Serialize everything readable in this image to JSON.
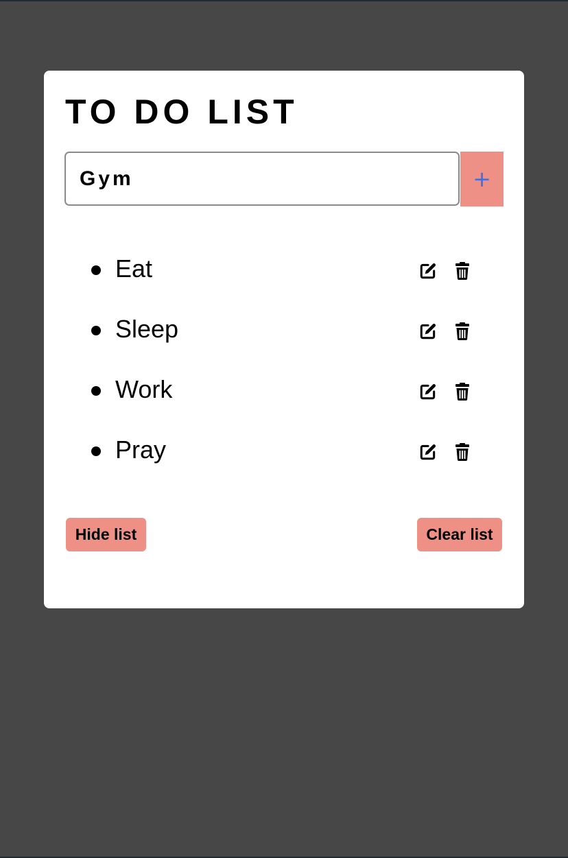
{
  "app": {
    "title": "TO DO LIST"
  },
  "input": {
    "value": "Gym",
    "placeholder": "",
    "add_label": "+"
  },
  "items": [
    {
      "label": "Eat"
    },
    {
      "label": "Sleep"
    },
    {
      "label": "Work"
    },
    {
      "label": "Pray"
    }
  ],
  "actions": {
    "hide_label": "Hide list",
    "clear_label": "Clear list"
  },
  "icons": {
    "edit": "edit-icon",
    "delete": "trash-icon",
    "add": "plus-icon"
  },
  "colors": {
    "background": "#474747",
    "card": "#ffffff",
    "accent": "#ee9085",
    "plus": "#3f6fe0"
  }
}
